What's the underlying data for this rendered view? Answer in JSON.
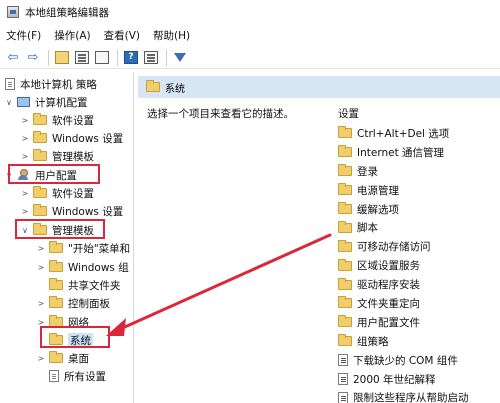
{
  "window": {
    "title": "本地组策略编辑器"
  },
  "menu": [
    "文件(F)",
    "操作(A)",
    "查看(V)",
    "帮助(H)"
  ],
  "toolbar": {
    "buttons": [
      "back-arrow-icon",
      "forward-arrow-icon",
      "up-folder-icon",
      "show-hide-tree-icon",
      "export-list-icon",
      "help-icon",
      "properties-icon",
      "filter-icon"
    ]
  },
  "tree": {
    "root": "本地计算机 策略",
    "computer_config": "计算机配置",
    "computer_children": [
      "软件设置",
      "Windows 设置",
      "管理模板"
    ],
    "user_config": "用户配置",
    "user_children": [
      "软件设置",
      "Windows 设置",
      "管理模板"
    ],
    "admin_templates_children": [
      "\"开始\"菜单和",
      "Windows 组",
      "共享文件夹",
      "控制面板",
      "网络",
      "系统",
      "桌面",
      "所有设置"
    ]
  },
  "right": {
    "header_title": "系统",
    "description": "选择一个项目来查看它的描述。",
    "column_header": "设置",
    "folders": [
      "Ctrl+Alt+Del 选项",
      "Internet 通信管理",
      "登录",
      "电源管理",
      "缓解选项",
      "脚本",
      "可移动存储访问",
      "区域设置服务",
      "驱动程序安装",
      "文件夹重定向",
      "用户配置文件",
      "组策略"
    ],
    "settings": [
      "下载缺少的 COM 组件",
      "2000 年世纪解释",
      "限制这些程序从帮助启动"
    ]
  },
  "colors": {
    "highlight_red": "#d9283a",
    "header_blue": "#d8e6f4",
    "folder_yellow": "#f2cd6b"
  }
}
